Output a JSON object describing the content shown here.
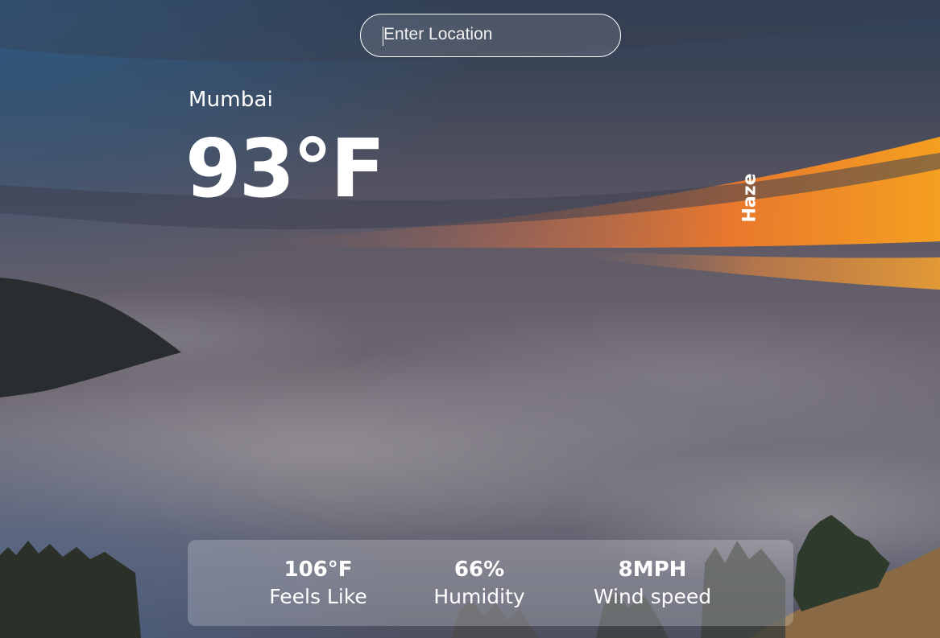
{
  "search": {
    "placeholder": "Enter Location",
    "value": ""
  },
  "current": {
    "city": "Mumbai",
    "temperature": "93°F",
    "condition": "Haze"
  },
  "stats": [
    {
      "value": "106°F",
      "label": "Feels Like"
    },
    {
      "value": "66%",
      "label": "Humidity"
    },
    {
      "value": "8MPH",
      "label": "Wind speed"
    }
  ]
}
